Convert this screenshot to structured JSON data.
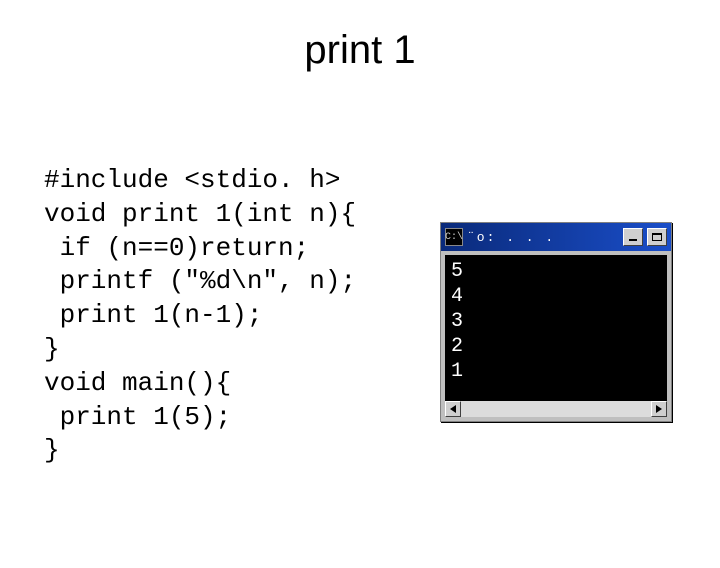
{
  "title": "print 1",
  "code_lines": [
    "#include <stdio. h>",
    "void print 1(int n){",
    " if (n==0)return;",
    " printf (\"%d\\n\", n);",
    " print 1(n-1);",
    "}",
    "void main(){",
    " print 1(5);",
    "}"
  ],
  "terminal": {
    "icon_glyph": "C:\\",
    "title": "¨o: . . .",
    "output_lines": [
      "5",
      "4",
      "3",
      "2",
      "1"
    ]
  }
}
